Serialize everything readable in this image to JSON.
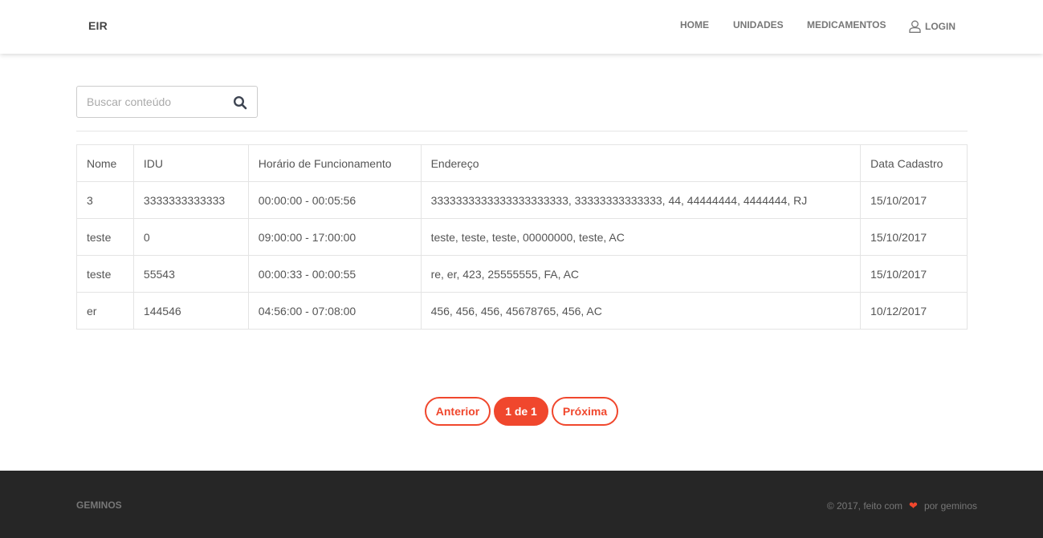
{
  "navbar": {
    "brand": "EIR",
    "links": {
      "home": "HOME",
      "unidades": "UNIDADES",
      "medicamentos": "MEDICAMENTOS",
      "login": "LOGIN"
    }
  },
  "search": {
    "placeholder": "Buscar conteúdo",
    "value": ""
  },
  "table": {
    "headers": {
      "nome": "Nome",
      "idu": "IDU",
      "horario": "Horário de Funcionamento",
      "endereco": "Endereço",
      "data": "Data Cadastro"
    },
    "rows": [
      {
        "nome": "3",
        "idu": "3333333333333",
        "horario": "00:00:00 - 00:05:56",
        "endereco": "3333333333333333333333, 33333333333333, 44, 44444444, 4444444, RJ",
        "data": "15/10/2017"
      },
      {
        "nome": "teste",
        "idu": "0",
        "horario": "09:00:00 - 17:00:00",
        "endereco": "teste, teste, teste, 00000000, teste, AC",
        "data": "15/10/2017"
      },
      {
        "nome": "teste",
        "idu": "55543",
        "horario": "00:00:33 - 00:00:55",
        "endereco": "re, er, 423, 25555555, FA, AC",
        "data": "15/10/2017"
      },
      {
        "nome": "er",
        "idu": "144546",
        "horario": "04:56:00 - 07:08:00",
        "endereco": "456, 456, 456, 45678765, 456, AC",
        "data": "10/12/2017"
      }
    ]
  },
  "pagination": {
    "previous": "Anterior",
    "current": "1 de 1",
    "next": "Próxima"
  },
  "footer": {
    "brand": "GEMINOS",
    "credit_prefix": "© 2017, feito com",
    "credit_suffix": "por geminos"
  },
  "colors": {
    "accent": "#f0472d",
    "footer_bg": "#262626"
  },
  "icons": {
    "search": "search-icon",
    "user": "user-icon",
    "heart": "heart-icon"
  }
}
